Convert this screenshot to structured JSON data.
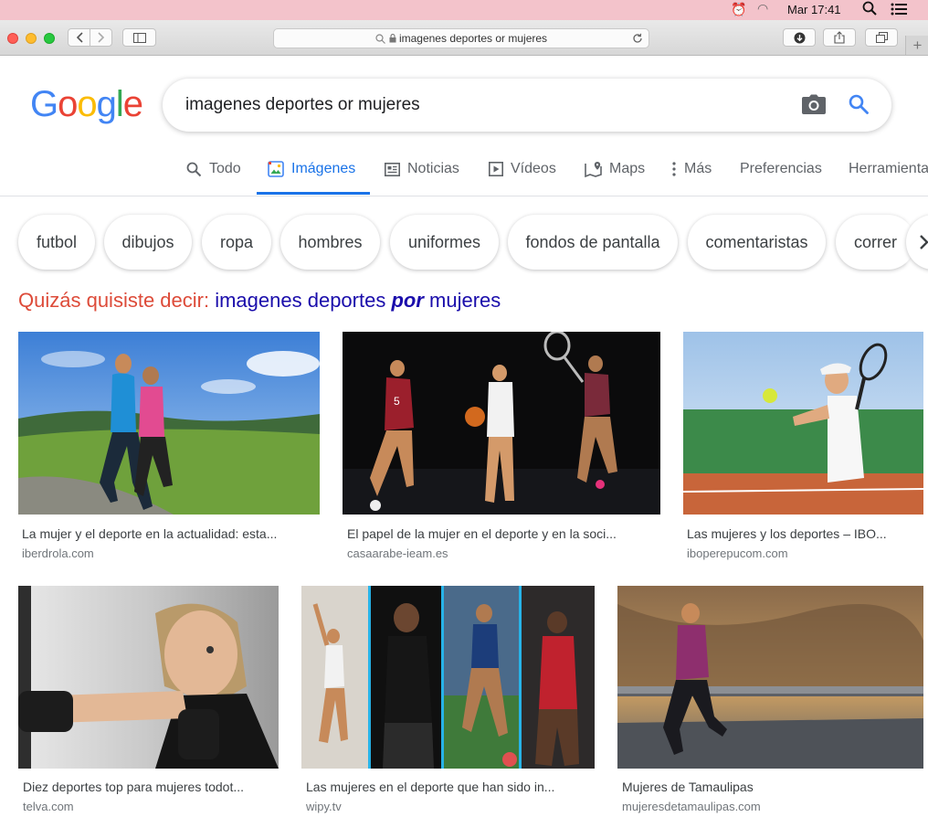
{
  "menubar": {
    "clock": "Mar 17:41"
  },
  "browser": {
    "url": "imagenes deportes or mujeres"
  },
  "logo": {
    "letters": [
      "G",
      "o",
      "o",
      "g",
      "l",
      "e"
    ],
    "colors": [
      "#4285f4",
      "#ea4335",
      "#fbbc05",
      "#4285f4",
      "#34a853",
      "#ea4335"
    ]
  },
  "search": {
    "query": "imagenes deportes or mujeres"
  },
  "nav": {
    "tabs": [
      {
        "label": "Todo",
        "icon": "search-icon"
      },
      {
        "label": "Imágenes",
        "icon": "image-icon"
      },
      {
        "label": "Noticias",
        "icon": "news-icon"
      },
      {
        "label": "Vídeos",
        "icon": "video-icon"
      },
      {
        "label": "Maps",
        "icon": "map-icon"
      },
      {
        "label": "Más",
        "icon": "more-vert-icon"
      }
    ],
    "preferences": "Preferencias",
    "tools": "Herramientas",
    "accent": "#1a73e8"
  },
  "chips": [
    "futbol",
    "dibujos",
    "ropa",
    "hombres",
    "uniformes",
    "fondos de pantalla",
    "comentaristas",
    "correr"
  ],
  "didyoumean": {
    "prefix": "Quizás quisiste decir:",
    "before": "imagenes deportes",
    "emph": "por",
    "after": "mujeres"
  },
  "results": [
    {
      "caption": "La mujer y el deporte en la actualidad: esta...",
      "source": "iberdrola.com"
    },
    {
      "caption": "El papel de la mujer en el deporte y en la soci...",
      "source": "casaarabe-ieam.es"
    },
    {
      "caption": "Las mujeres y los deportes – IBO...",
      "source": "iboperepucom.com"
    },
    {
      "caption": "Diez deportes top para mujeres todot...",
      "source": "telva.com"
    },
    {
      "caption": "Las mujeres en el deporte que han sido in...",
      "source": "wipy.tv"
    },
    {
      "caption": "Mujeres de Tamaulipas",
      "source": "mujeresdetamaulipas.com"
    }
  ]
}
